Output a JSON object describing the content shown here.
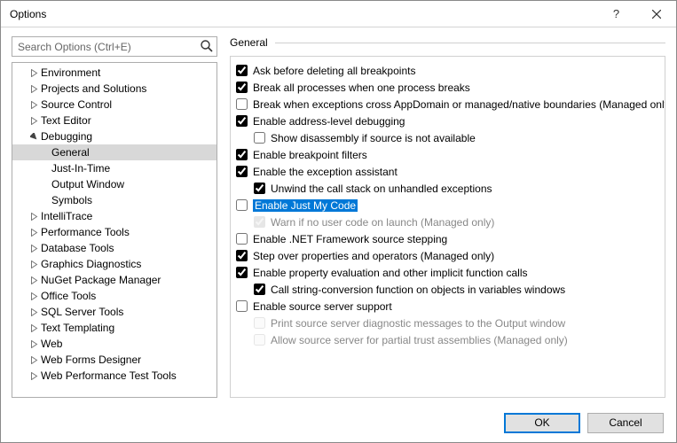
{
  "window": {
    "title": "Options"
  },
  "search": {
    "placeholder": "Search Options (Ctrl+E)"
  },
  "tree": [
    {
      "label": "Environment",
      "expanded": false,
      "depth": 0
    },
    {
      "label": "Projects and Solutions",
      "expanded": false,
      "depth": 0
    },
    {
      "label": "Source Control",
      "expanded": false,
      "depth": 0
    },
    {
      "label": "Text Editor",
      "expanded": false,
      "depth": 0
    },
    {
      "label": "Debugging",
      "expanded": true,
      "depth": 0
    },
    {
      "label": "General",
      "depth": 1,
      "selected": true
    },
    {
      "label": "Just-In-Time",
      "depth": 1
    },
    {
      "label": "Output Window",
      "depth": 1
    },
    {
      "label": "Symbols",
      "depth": 1
    },
    {
      "label": "IntelliTrace",
      "expanded": false,
      "depth": 0
    },
    {
      "label": "Performance Tools",
      "expanded": false,
      "depth": 0
    },
    {
      "label": "Database Tools",
      "expanded": false,
      "depth": 0
    },
    {
      "label": "Graphics Diagnostics",
      "expanded": false,
      "depth": 0
    },
    {
      "label": "NuGet Package Manager",
      "expanded": false,
      "depth": 0
    },
    {
      "label": "Office Tools",
      "expanded": false,
      "depth": 0
    },
    {
      "label": "SQL Server Tools",
      "expanded": false,
      "depth": 0
    },
    {
      "label": "Text Templating",
      "expanded": false,
      "depth": 0
    },
    {
      "label": "Web",
      "expanded": false,
      "depth": 0
    },
    {
      "label": "Web Forms Designer",
      "expanded": false,
      "depth": 0
    },
    {
      "label": "Web Performance Test Tools",
      "expanded": false,
      "depth": 0
    }
  ],
  "panel": {
    "header": "General",
    "items": [
      {
        "label": "Ask before deleting all breakpoints",
        "checked": true,
        "level": 1
      },
      {
        "label": "Break all processes when one process breaks",
        "checked": true,
        "level": 1
      },
      {
        "label": "Break when exceptions cross AppDomain or managed/native boundaries (Managed only)",
        "checked": false,
        "level": 1
      },
      {
        "label": "Enable address-level debugging",
        "checked": true,
        "level": 1
      },
      {
        "label": "Show disassembly if source is not available",
        "checked": false,
        "level": 2
      },
      {
        "label": "Enable breakpoint filters",
        "checked": true,
        "level": 1
      },
      {
        "label": "Enable the exception assistant",
        "checked": true,
        "level": 1
      },
      {
        "label": "Unwind the call stack on unhandled exceptions",
        "checked": true,
        "level": 2
      },
      {
        "label": "Enable Just My Code",
        "checked": false,
        "level": 1,
        "highlighted": true
      },
      {
        "label": "Warn if no user code on launch (Managed only)",
        "checked": true,
        "level": 2,
        "disabled": true
      },
      {
        "label": "Enable .NET Framework source stepping",
        "checked": false,
        "level": 1
      },
      {
        "label": "Step over properties and operators (Managed only)",
        "checked": true,
        "level": 1
      },
      {
        "label": "Enable property evaluation and other implicit function calls",
        "checked": true,
        "level": 1
      },
      {
        "label": "Call string-conversion function on objects in variables windows",
        "checked": true,
        "level": 2
      },
      {
        "label": "Enable source server support",
        "checked": false,
        "level": 1
      },
      {
        "label": "Print source server diagnostic messages to the Output window",
        "checked": false,
        "level": 2,
        "disabled": true
      },
      {
        "label": "Allow source server for partial trust assemblies (Managed only)",
        "checked": false,
        "level": 2,
        "disabled": true
      }
    ]
  },
  "buttons": {
    "ok": "OK",
    "cancel": "Cancel"
  }
}
